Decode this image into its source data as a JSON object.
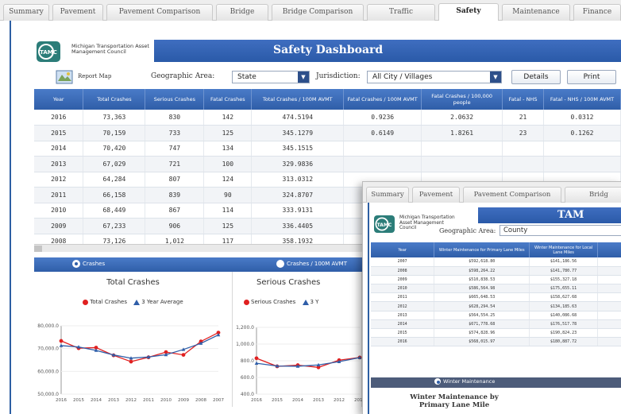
{
  "main": {
    "tabs": [
      {
        "label": "Summary",
        "active": false
      },
      {
        "label": "Pavement",
        "active": false
      },
      {
        "label": "Pavement Comparison",
        "active": false
      },
      {
        "label": "Bridge",
        "active": false
      },
      {
        "label": "Bridge Comparison",
        "active": false
      },
      {
        "label": "Traffic",
        "active": false
      },
      {
        "label": "Safety",
        "active": true
      },
      {
        "label": "Maintenance",
        "active": false
      },
      {
        "label": "Finance",
        "active": false
      }
    ],
    "logo_mark": "TAMC",
    "logo_text": "Michigan Transportation Asset Management Council",
    "title": "Safety Dashboard",
    "toolbar": {
      "report_map_label": "Report Map",
      "geo_label": "Geographic Area:",
      "geo_value": "State",
      "jurisdiction_label": "Jurisdiction:",
      "jurisdiction_value": "All City / Villages",
      "details_label": "Details",
      "print_label": "Print"
    },
    "table": {
      "headers": [
        "Year",
        "Total Crashes",
        "Serious Crashes",
        "Fatal Crashes",
        "Total Crashes / 100M AVMT",
        "Fatal Crashes / 100M AVMT",
        "Fatal Crashes / 100,000 people",
        "Fatal - NHS",
        "Fatal - NHS / 100M AVMT"
      ],
      "rows": [
        [
          "2016",
          "73,363",
          "830",
          "142",
          "474.5194",
          "0.9236",
          "2.0632",
          "21",
          "0.0312"
        ],
        [
          "2015",
          "70,159",
          "733",
          "125",
          "345.1279",
          "0.6149",
          "1.8261",
          "23",
          "0.1262"
        ],
        [
          "2014",
          "70,420",
          "747",
          "134",
          "345.1515",
          "",
          "",
          "",
          ""
        ],
        [
          "2013",
          "67,029",
          "721",
          "100",
          "329.9836",
          "",
          "",
          "",
          ""
        ],
        [
          "2012",
          "64,284",
          "807",
          "124",
          "313.0312",
          "",
          "",
          "",
          ""
        ],
        [
          "2011",
          "66,158",
          "839",
          "90",
          "324.8707",
          "",
          "",
          "",
          ""
        ],
        [
          "2010",
          "68,449",
          "867",
          "114",
          "333.9131",
          "",
          "",
          "",
          ""
        ],
        [
          "2009",
          "67,233",
          "906",
          "125",
          "336.4405",
          "",
          "",
          "",
          ""
        ],
        [
          "2008",
          "73,126",
          "1,012",
          "117",
          "358.1932",
          "",
          "",
          "",
          ""
        ]
      ]
    },
    "chart_tabs": {
      "crashes": "Crashes",
      "crashes_avmt": "Crashes / 100M AVMT"
    },
    "charts": [
      {
        "title": "Total Crashes",
        "legend": [
          "Total Crashes",
          "3 Year Average"
        ],
        "y_ticks": [
          "80,000.0",
          "70,000.0",
          "60,000.0",
          "50,000.0"
        ],
        "x_ticks": [
          "2016",
          "2015",
          "2014",
          "2013",
          "2012",
          "2011",
          "2010",
          "2009",
          "2008",
          "2007"
        ]
      },
      {
        "title": "Serious Crashes",
        "legend": [
          "Serious Crashes",
          "3 Y"
        ],
        "y_ticks": [
          "1,200.0",
          "1,000.0",
          "800.0",
          "600.0",
          "400.0"
        ],
        "x_ticks": [
          "2016",
          "2015",
          "2014",
          "2013",
          "2012",
          "2011"
        ]
      }
    ]
  },
  "overlay": {
    "tabs": [
      {
        "label": "Summary"
      },
      {
        "label": "Pavement"
      },
      {
        "label": "Pavement Comparison"
      },
      {
        "label": "Bridg"
      }
    ],
    "logo_mark": "TAMC",
    "logo_text": "Michigan Transportation Asset Management Council",
    "title": "TAM",
    "geo_label": "Geographic Area:",
    "geo_value": "County",
    "table": {
      "headers": [
        "Year",
        "Winter Maintenance for Primary Lane Miles",
        "Winter Maintenance for Local Lane Miles",
        ""
      ],
      "rows": [
        [
          "2007",
          "$592,618.80",
          "$141,186.56",
          ""
        ],
        [
          "2008",
          "$598,264.22",
          "$141,780.77",
          ""
        ],
        [
          "2009",
          "$510,838.53",
          "$155,327.18",
          ""
        ],
        [
          "2010",
          "$586,564.98",
          "$175,655.11",
          ""
        ],
        [
          "2011",
          "$665,648.53",
          "$158,627.68",
          ""
        ],
        [
          "2012",
          "$628,294.54",
          "$134,185.63",
          ""
        ],
        [
          "2013",
          "$564,554.25",
          "$140,086.68",
          ""
        ],
        [
          "2014",
          "$671,778.68",
          "$176,517.78",
          ""
        ],
        [
          "2015",
          "$574,828.96",
          "$190,824.23",
          ""
        ],
        [
          "2016",
          "$568,015.97",
          "$180,887.72",
          ""
        ]
      ]
    },
    "chart_tab": "Winter Maintenance",
    "chart_title": "Winter Maintenance by Primary Lane Mile"
  },
  "colors": {
    "header_blue": "#2f5ea8",
    "total_series": "#e02020",
    "avg_series": "#2f5ea8"
  },
  "chart_data": [
    {
      "type": "line",
      "title": "Total Crashes",
      "categories": [
        "2016",
        "2015",
        "2014",
        "2013",
        "2012",
        "2011",
        "2010",
        "2009",
        "2008",
        "2007"
      ],
      "series": [
        {
          "name": "Total Crashes",
          "values": [
            73363,
            70159,
            70420,
            67029,
            64284,
            66158,
            68449,
            67233,
            73126,
            77000
          ]
        },
        {
          "name": "3 Year Average",
          "values": [
            71300,
            70700,
            69200,
            67200,
            65800,
            66300,
            67300,
            69600,
            72300,
            76000
          ]
        }
      ],
      "ylim": [
        50000,
        80000
      ]
    },
    {
      "type": "line",
      "title": "Serious Crashes",
      "categories": [
        "2016",
        "2015",
        "2014",
        "2013",
        "2012",
        "2011"
      ],
      "series": [
        {
          "name": "Serious Crashes",
          "values": [
            830,
            733,
            747,
            721,
            807,
            839
          ]
        },
        {
          "name": "3 Y",
          "values": [
            770,
            737,
            734,
            750,
            789,
            838
          ]
        }
      ],
      "ylim": [
        400,
        1200
      ]
    }
  ]
}
